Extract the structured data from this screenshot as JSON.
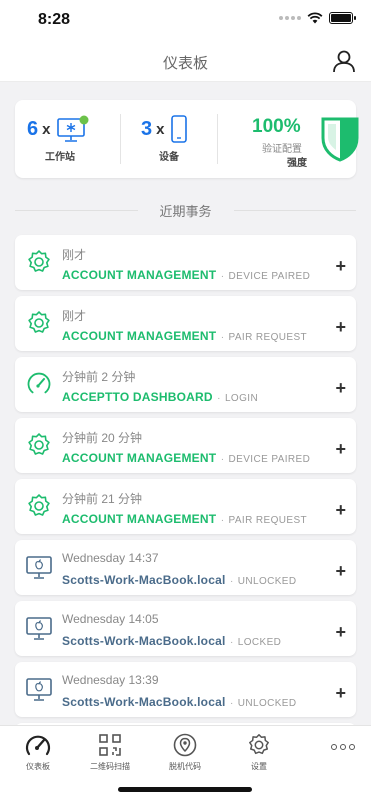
{
  "status_bar": {
    "time": "8:28"
  },
  "header": {
    "title": "仪表板"
  },
  "summary": {
    "workstations": {
      "count": "6",
      "times": "x",
      "label": "工作站"
    },
    "devices": {
      "count": "3",
      "times": "x",
      "label": "设备"
    },
    "strength": {
      "percent": "100%",
      "caption": "验证配置",
      "label": "强度"
    }
  },
  "recent": {
    "title": "近期事务"
  },
  "events": [
    {
      "icon": "gear-icon",
      "time": "刚才",
      "title": "ACCOUNT MANAGEMENT",
      "sep": "·",
      "action": "DEVICE PAIRED"
    },
    {
      "icon": "gear-icon",
      "time": "刚才",
      "title": "ACCOUNT MANAGEMENT",
      "sep": "·",
      "action": "PAIR REQUEST"
    },
    {
      "icon": "gauge-icon",
      "time": "分钟前 2 分钟",
      "title": "ACCEPTTO DASHBOARD",
      "sep": "·",
      "action": "LOGIN"
    },
    {
      "icon": "gear-icon",
      "time": "分钟前 20 分钟",
      "title": "ACCOUNT MANAGEMENT",
      "sep": "·",
      "action": "DEVICE PAIRED"
    },
    {
      "icon": "gear-icon",
      "time": "分钟前 21 分钟",
      "title": "ACCOUNT MANAGEMENT",
      "sep": "·",
      "action": "PAIR REQUEST"
    },
    {
      "icon": "mac-icon",
      "time": "Wednesday   14:37",
      "title": "Scotts-Work-MacBook.local",
      "sep": "·",
      "action": "UNLOCKED"
    },
    {
      "icon": "mac-icon",
      "time": "Wednesday   14:05",
      "title": "Scotts-Work-MacBook.local",
      "sep": "·",
      "action": "LOCKED"
    },
    {
      "icon": "mac-icon",
      "time": "Wednesday   13:39",
      "title": "Scotts-Work-MacBook.local",
      "sep": "·",
      "action": "UNLOCKED"
    }
  ],
  "plus_symbol": "+",
  "tabs": [
    {
      "label": "仪表板",
      "icon": "dashboard-icon"
    },
    {
      "label": "二维码扫描",
      "icon": "qr-code-icon"
    },
    {
      "label": "脱机代码",
      "icon": "offline-code-icon"
    },
    {
      "label": "设置",
      "icon": "gear-icon"
    }
  ],
  "colors": {
    "green": "#1dbc6e",
    "blue": "#1a73e8",
    "mac_text": "#4a6b8a"
  }
}
